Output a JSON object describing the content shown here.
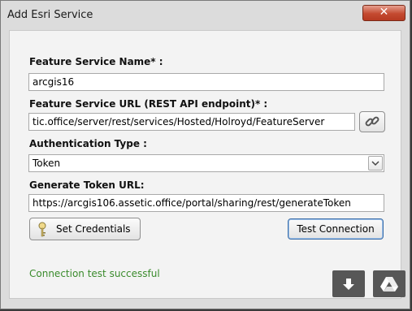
{
  "window": {
    "title": "Add Esri Service",
    "close_label": "✕"
  },
  "form": {
    "feature_service_name_label": "Feature Service Name* :",
    "feature_service_name_value": "arcgis16",
    "feature_service_url_label": "Feature Service URL (REST API endpoint)* :",
    "feature_service_url_value": "tic.office/server/rest/services/Hosted/Holroyd/FeatureServer",
    "auth_type_label": "Authentication Type :",
    "auth_type_value": "Token",
    "token_url_label": "Generate Token URL:",
    "token_url_value": "https://arcgis106.assetic.office/portal/sharing/rest/generateToken"
  },
  "buttons": {
    "set_credentials": "Set Credentials",
    "test_connection": "Test Connection"
  },
  "status": {
    "message": "Connection test successful",
    "color": "#3a8b2c"
  },
  "icons": {
    "link": "link-icon",
    "dropdown": "chevron-down-icon",
    "key": "key-icon",
    "download": "download-icon",
    "drive": "drive-icon"
  }
}
